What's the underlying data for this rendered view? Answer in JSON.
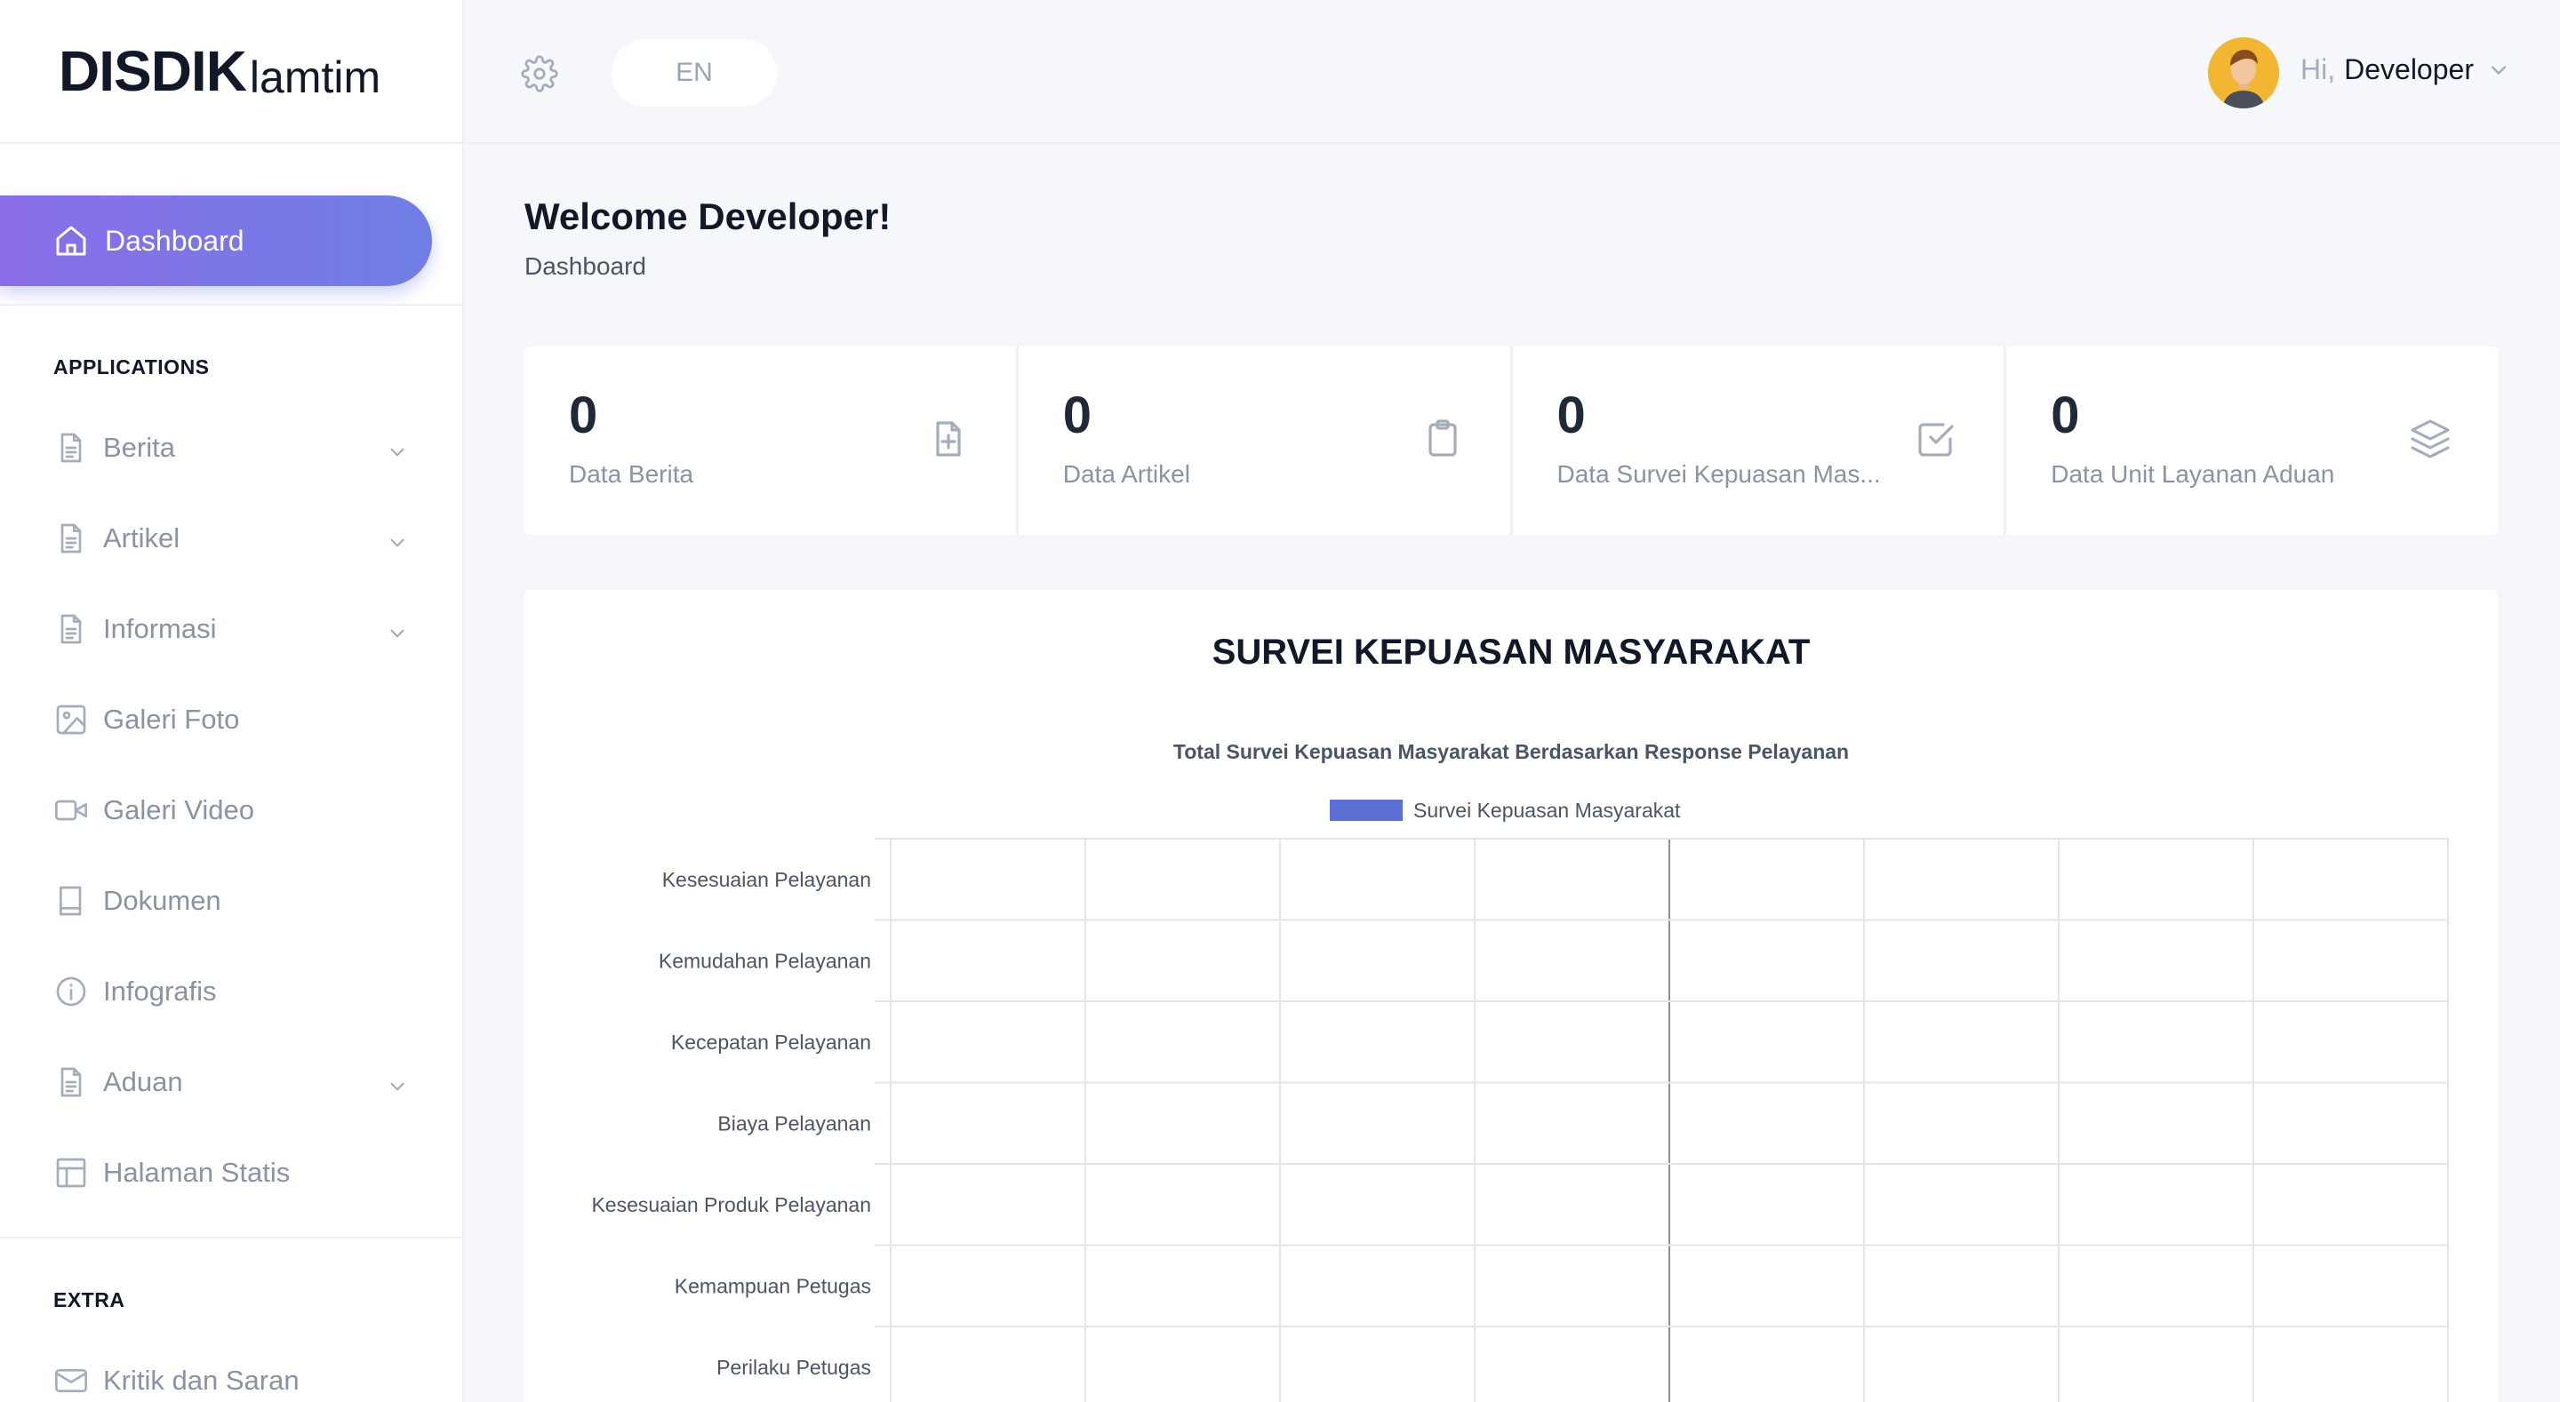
{
  "brand": {
    "bold": "DISDIK",
    "light": "lamtim"
  },
  "header": {
    "lang": "EN",
    "greeting": "Hi,",
    "user": "Developer"
  },
  "sidebar": {
    "dashboard": "Dashboard",
    "section_applications": "APPLICATIONS",
    "section_extra": "EXTRA",
    "items": [
      {
        "label": "Berita",
        "icon": "file-text-icon",
        "has_children": true
      },
      {
        "label": "Artikel",
        "icon": "file-text-icon",
        "has_children": true
      },
      {
        "label": "Informasi",
        "icon": "file-text-icon",
        "has_children": true
      },
      {
        "label": "Galeri Foto",
        "icon": "image-icon",
        "has_children": false
      },
      {
        "label": "Galeri Video",
        "icon": "video-icon",
        "has_children": false
      },
      {
        "label": "Dokumen",
        "icon": "book-icon",
        "has_children": false
      },
      {
        "label": "Infografis",
        "icon": "info-icon",
        "has_children": false
      },
      {
        "label": "Aduan",
        "icon": "file-text-icon",
        "has_children": true
      },
      {
        "label": "Halaman Statis",
        "icon": "layout-icon",
        "has_children": false
      }
    ],
    "extra_items": [
      {
        "label": "Kritik dan Saran",
        "icon": "mail-icon"
      }
    ]
  },
  "main": {
    "welcome": "Welcome Developer!",
    "breadcrumb": "Dashboard",
    "stats": [
      {
        "value": "0",
        "label": "Data Berita",
        "icon": "file-plus-icon"
      },
      {
        "value": "0",
        "label": "Data Artikel",
        "icon": "clipboard-icon"
      },
      {
        "value": "0",
        "label": "Data Survei Kepuasan Mas...",
        "icon": "check-square-icon"
      },
      {
        "value": "0",
        "label": "Data Unit Layanan Aduan",
        "icon": "layers-icon"
      }
    ],
    "chart_card_title": "SURVEI KEPUASAN MASYARAKAT"
  },
  "chart_data": {
    "type": "bar",
    "orientation": "horizontal",
    "title": "Total Survei Kepuasan Masyarakat Berdasarkan Response Pelayanan",
    "categories": [
      "Kesesuaian Pelayanan",
      "Kemudahan Pelayanan",
      "Kecepatan Pelayanan",
      "Biaya Pelayanan",
      "Kesesuaian Produk Pelayanan",
      "Kemampuan Petugas",
      "Perilaku Petugas"
    ],
    "series": [
      {
        "name": "Survei Kepuasan Masyarakat",
        "values": [
          0,
          0,
          0,
          0,
          0,
          0,
          0
        ],
        "color": "#5b6fd6"
      }
    ],
    "legend": "top",
    "grid": true
  },
  "colors": {
    "accent_start": "#8a6de8",
    "accent_end": "#6f7fe6",
    "series": "#5b6fd6"
  }
}
